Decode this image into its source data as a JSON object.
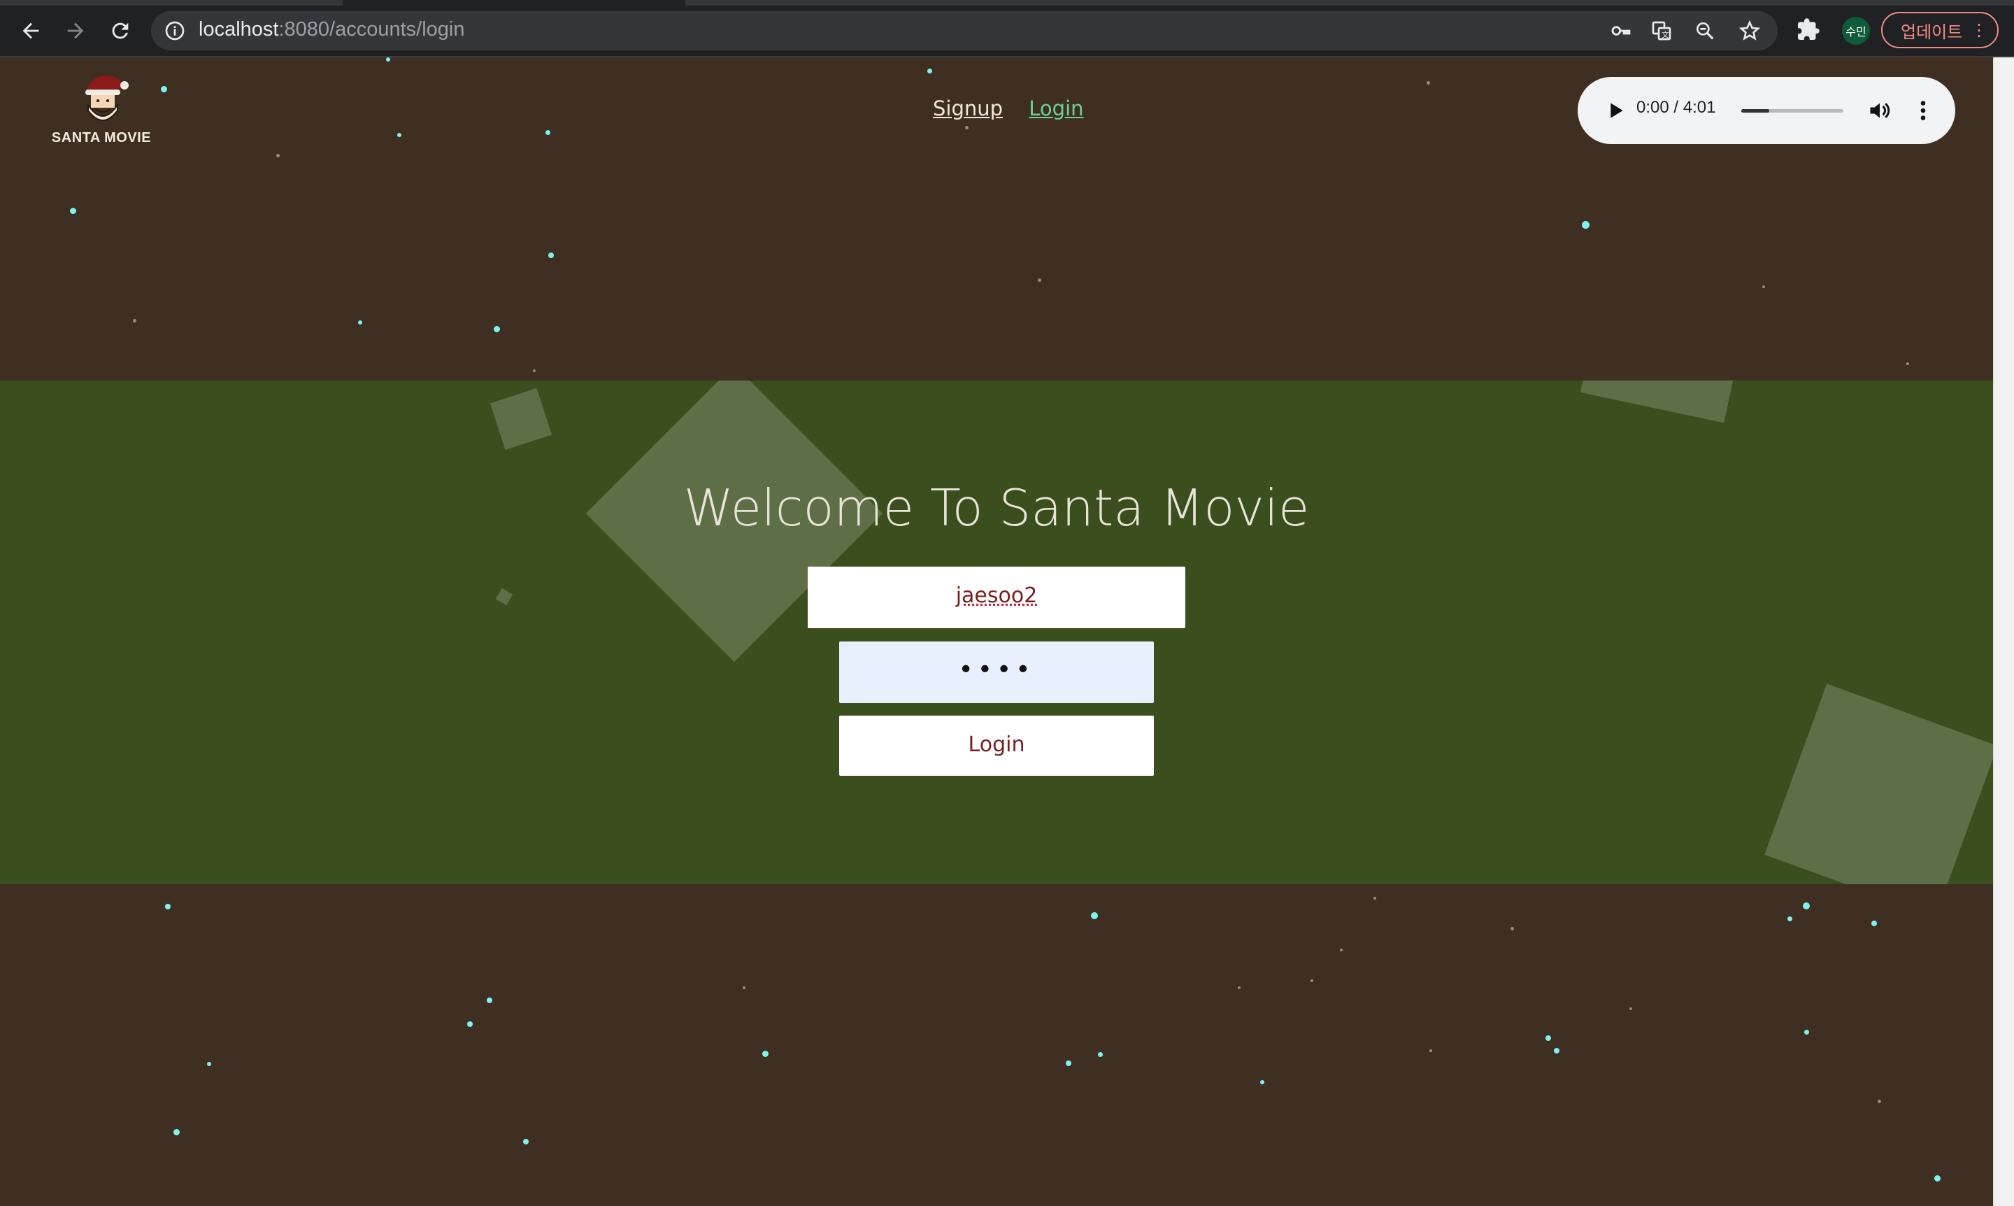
{
  "browser": {
    "url_host": "localhost",
    "url_path": ":8080/accounts/login",
    "profile_label": "수민",
    "update_label": "업데이트"
  },
  "header": {
    "logo_text": "SANTA MOVIE",
    "nav": {
      "signup_label": "Signup",
      "login_label": "Login"
    },
    "audio": {
      "time_label": "0:00 / 4:01",
      "progress_fraction": 0
    }
  },
  "login_form": {
    "title": "Welcome To Santa Movie",
    "username_value": "jaesoo2",
    "password_value": "••••",
    "submit_label": "Login"
  },
  "colors": {
    "page_background": "#3f2f22",
    "band_background": "#3b4f1e",
    "active_link": "#6fcf97",
    "snow": "#7ff3f0"
  }
}
